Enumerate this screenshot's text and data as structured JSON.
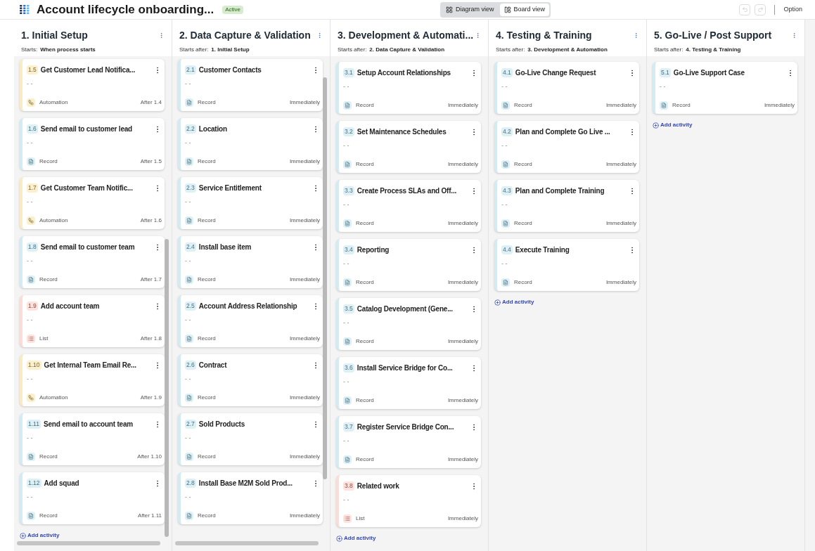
{
  "header": {
    "title": "Account lifecycle onboarding...",
    "status": "Active",
    "view_toggle": [
      {
        "label": "Diagram view",
        "selected": false
      },
      {
        "label": "Board view",
        "selected": true
      }
    ],
    "undo": {
      "disabled": true
    },
    "redo": {
      "disabled": true
    },
    "options": "Option"
  },
  "columns": [
    {
      "title": "1. Initial Setup",
      "starts_label": "Starts:",
      "starts_value": "When process starts",
      "scrolled": true,
      "add_activity": "Add activity",
      "cards": [
        {
          "number": "1.5",
          "title": "Get Customer Lead Notifica...",
          "description": "- -",
          "kind": "automation",
          "kind_label": "Automation",
          "timing": "After 1.4"
        },
        {
          "number": "1.6",
          "title": "Send email to customer lead",
          "description": "- -",
          "kind": "record",
          "kind_label": "Record",
          "timing": "After 1.5"
        },
        {
          "number": "1.7",
          "title": "Get Customer Team Notific...",
          "description": "- -",
          "kind": "automation",
          "kind_label": "Automation",
          "timing": "After 1.6"
        },
        {
          "number": "1.8",
          "title": "Send email to customer team",
          "description": "- -",
          "kind": "record",
          "kind_label": "Record",
          "timing": "After 1.7"
        },
        {
          "number": "1.9",
          "title": "Add account team",
          "description": "- -",
          "kind": "list",
          "kind_label": "List",
          "timing": "After 1.8"
        },
        {
          "number": "1.10",
          "title": "Get Internal Team Email Re...",
          "description": "- -",
          "kind": "automation",
          "kind_label": "Automation",
          "timing": "After 1.9"
        },
        {
          "number": "1.11",
          "title": "Send email to account team",
          "description": "- -",
          "kind": "record",
          "kind_label": "Record",
          "timing": "After 1.10"
        },
        {
          "number": "1.12",
          "title": "Add squad",
          "description": "- -",
          "kind": "record",
          "kind_label": "Record",
          "timing": "After 1.11"
        }
      ]
    },
    {
      "title": "2. Data Capture & Validation",
      "starts_label": "Starts after:",
      "starts_value": "1. Initial Setup",
      "scrolled": true,
      "cards": [
        {
          "number": "2.1",
          "title": "Customer Contacts",
          "description": "- -",
          "kind": "record",
          "kind_label": "Record",
          "timing": "Immediately"
        },
        {
          "number": "2.2",
          "title": "Location",
          "description": "- -",
          "kind": "record",
          "kind_label": "Record",
          "timing": "Immediately"
        },
        {
          "number": "2.3",
          "title": "Service Entitlement",
          "description": "- -",
          "kind": "record",
          "kind_label": "Record",
          "timing": "Immediately"
        },
        {
          "number": "2.4",
          "title": "Install base item",
          "description": "- -",
          "kind": "record",
          "kind_label": "Record",
          "timing": "Immediately"
        },
        {
          "number": "2.5",
          "title": "Account Address Relationship",
          "description": "- -",
          "kind": "record",
          "kind_label": "Record",
          "timing": "Immediately"
        },
        {
          "number": "2.6",
          "title": "Contract",
          "description": "- -",
          "kind": "record",
          "kind_label": "Record",
          "timing": "Immediately"
        },
        {
          "number": "2.7",
          "title": "Sold Products",
          "description": "- -",
          "kind": "record",
          "kind_label": "Record",
          "timing": "Immediately"
        },
        {
          "number": "2.8",
          "title": "Install Base M2M Sold Prod...",
          "description": "- -",
          "kind": "record",
          "kind_label": "Record",
          "timing": "Immediately"
        }
      ]
    },
    {
      "title": "3. Development & Automati...",
      "starts_label": "Starts after:",
      "starts_value": "2. Data Capture & Validation",
      "scrolled": false,
      "add_activity": "Add activity",
      "cards": [
        {
          "number": "3.1",
          "title": "Setup Account Relationships",
          "description": "- -",
          "kind": "record",
          "kind_label": "Record",
          "timing": "Immediately"
        },
        {
          "number": "3.2",
          "title": "Set Maintenance Schedules",
          "description": "- -",
          "kind": "record",
          "kind_label": "Record",
          "timing": "Immediately"
        },
        {
          "number": "3.3",
          "title": "Create Process SLAs and Off...",
          "description": "- -",
          "kind": "record",
          "kind_label": "Record",
          "timing": "Immediately"
        },
        {
          "number": "3.4",
          "title": "Reporting",
          "description": "- -",
          "kind": "record",
          "kind_label": "Record",
          "timing": "Immediately"
        },
        {
          "number": "3.5",
          "title": "Catalog Development (Gene...",
          "description": "- -",
          "kind": "record",
          "kind_label": "Record",
          "timing": "Immediately"
        },
        {
          "number": "3.6",
          "title": "Install Service Bridge for Co...",
          "description": "- -",
          "kind": "record",
          "kind_label": "Record",
          "timing": "Immediately"
        },
        {
          "number": "3.7",
          "title": "Register Service Bridge Con...",
          "description": "- -",
          "kind": "record",
          "kind_label": "Record",
          "timing": "Immediately"
        },
        {
          "number": "3.8",
          "title": "Related work",
          "description": "- -",
          "kind": "list",
          "kind_label": "List",
          "timing": "Immediately"
        }
      ]
    },
    {
      "title": "4. Testing & Training",
      "starts_label": "Starts after:",
      "starts_value": "3. Development & Automation",
      "scrolled": false,
      "add_activity": "Add activity",
      "cards": [
        {
          "number": "4.1",
          "title": "Go-Live Change Request",
          "description": "- -",
          "kind": "record",
          "kind_label": "Record",
          "timing": "Immediately"
        },
        {
          "number": "4.2",
          "title": "Plan and Complete Go Live ...",
          "description": "- -",
          "kind": "record",
          "kind_label": "Record",
          "timing": "Immediately"
        },
        {
          "number": "4.3",
          "title": "Plan and Complete Training",
          "description": "- -",
          "kind": "record",
          "kind_label": "Record",
          "timing": "Immediately"
        },
        {
          "number": "4.4",
          "title": "Execute Training",
          "description": "- -",
          "kind": "record",
          "kind_label": "Record",
          "timing": "Immediately"
        }
      ]
    },
    {
      "title": "5. Go-Live / Post Support",
      "starts_label": "Starts after:",
      "starts_value": "4. Testing & Training",
      "scrolled": false,
      "add_activity": "Add activity",
      "cards": [
        {
          "number": "5.1",
          "title": "Go-Live Support Case",
          "description": "- -",
          "kind": "record",
          "kind_label": "Record",
          "timing": "Immediately"
        }
      ]
    }
  ]
}
